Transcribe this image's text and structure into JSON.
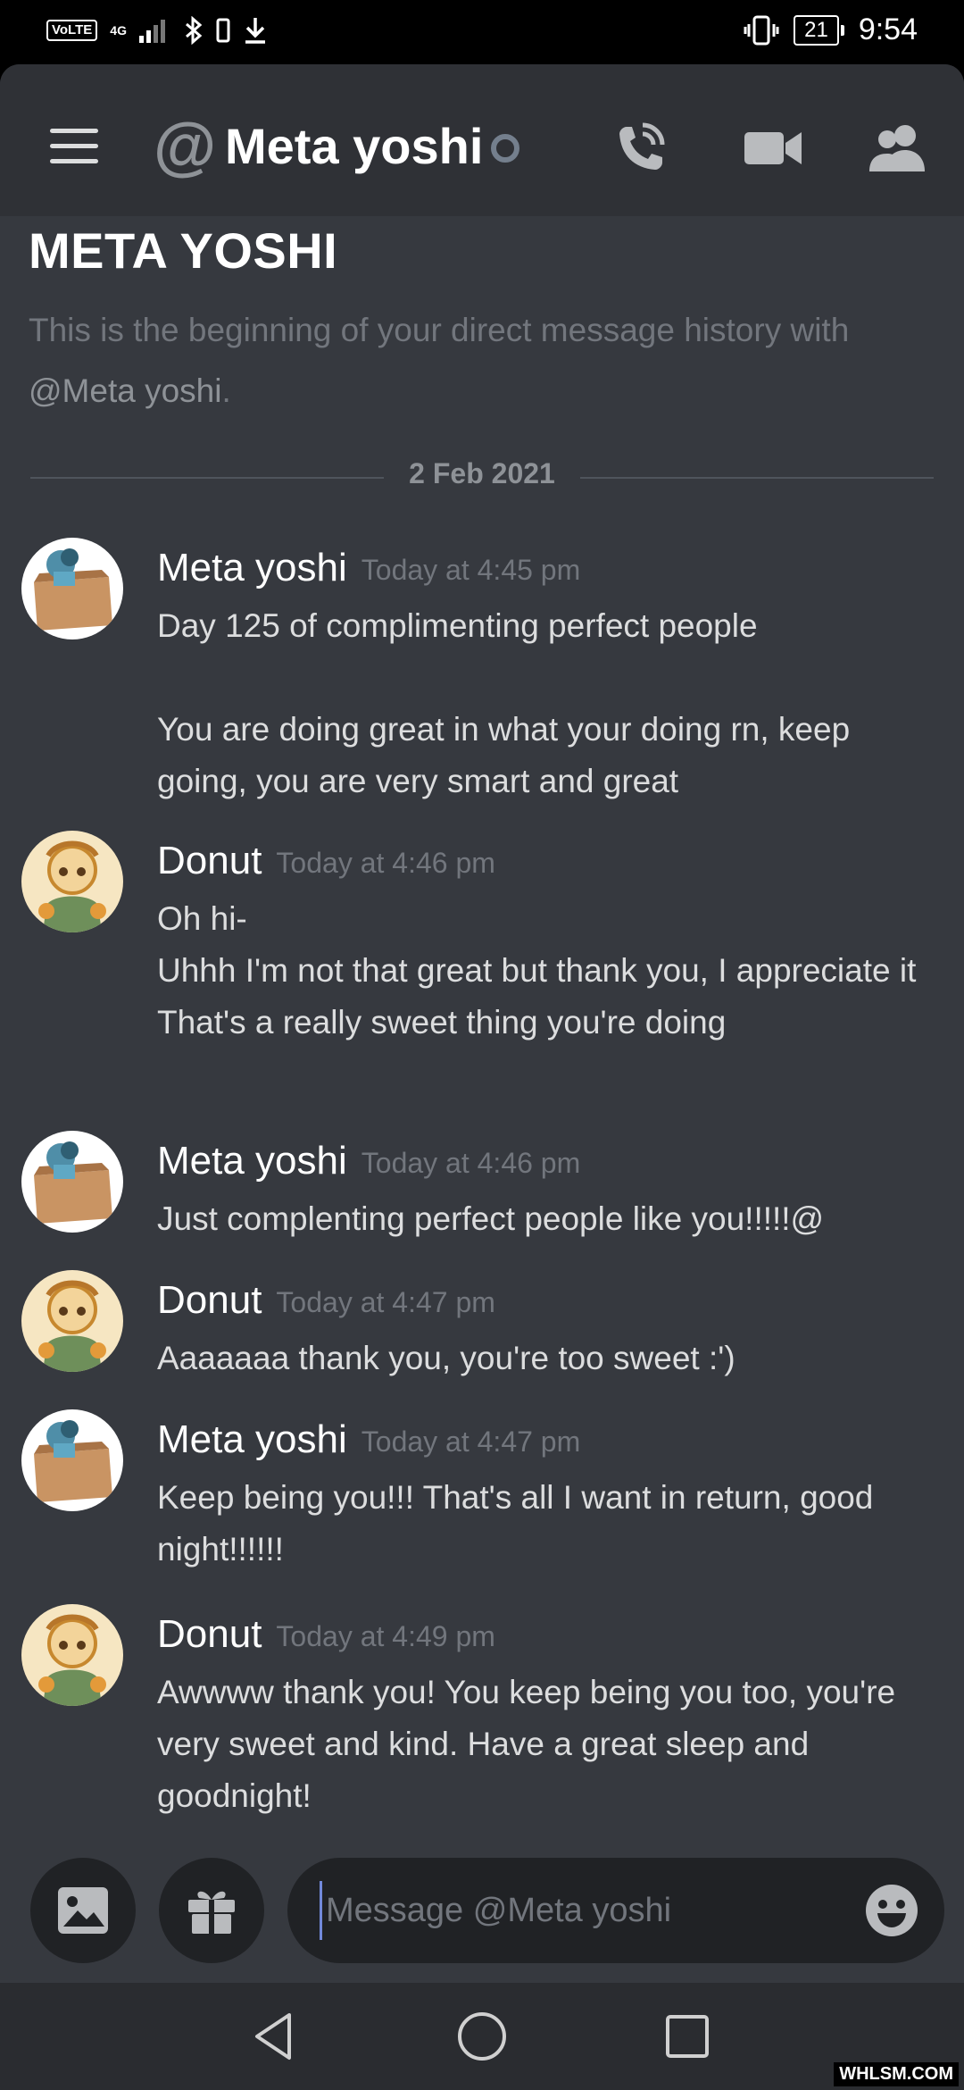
{
  "status_bar": {
    "volte": "VoLTE",
    "network": "4G",
    "battery": "21",
    "time": "9:54"
  },
  "header": {
    "title": "Meta yoshi",
    "at_symbol": "@"
  },
  "intro": {
    "heading": "META YOSHI",
    "text_before": "This is the beginning of your direct message history with",
    "mention": "@Meta yoshi",
    "text_after": "."
  },
  "date_divider": "2 Feb 2021",
  "messages": [
    {
      "author": "Meta yoshi",
      "time": "Today at 4:45 pm",
      "text": "Day 125 of complimenting perfect people\n\nYou are doing great in what your doing rn, keep going, you are very smart and great"
    },
    {
      "author": "Donut",
      "time": "Today at 4:46 pm",
      "text": "Oh hi-\nUhhh I'm not that great but thank you, I appreciate it\nThat's a really sweet thing you're doing"
    },
    {
      "author": "Meta yoshi",
      "time": "Today at 4:46 pm",
      "text": "Just complenting perfect people like you!!!!!@"
    },
    {
      "author": "Donut",
      "time": "Today at 4:47 pm",
      "text": "Aaaaaaa thank you, you're too sweet :')"
    },
    {
      "author": "Meta yoshi",
      "time": "Today at 4:47 pm",
      "text": "Keep being you!!! That's all I want in return, good night!!!!!!"
    },
    {
      "author": "Donut",
      "time": "Today at 4:49 pm",
      "text": "Awwww thank you! You keep being you too, you're very sweet and kind. Have a great sleep and goodnight!"
    }
  ],
  "input": {
    "placeholder": "Message @Meta yoshi"
  },
  "watermark": "WHLSM.COM",
  "colors": {
    "background": "#36393f",
    "header": "#2f3136",
    "input": "#202225",
    "accent": "#7289da"
  }
}
